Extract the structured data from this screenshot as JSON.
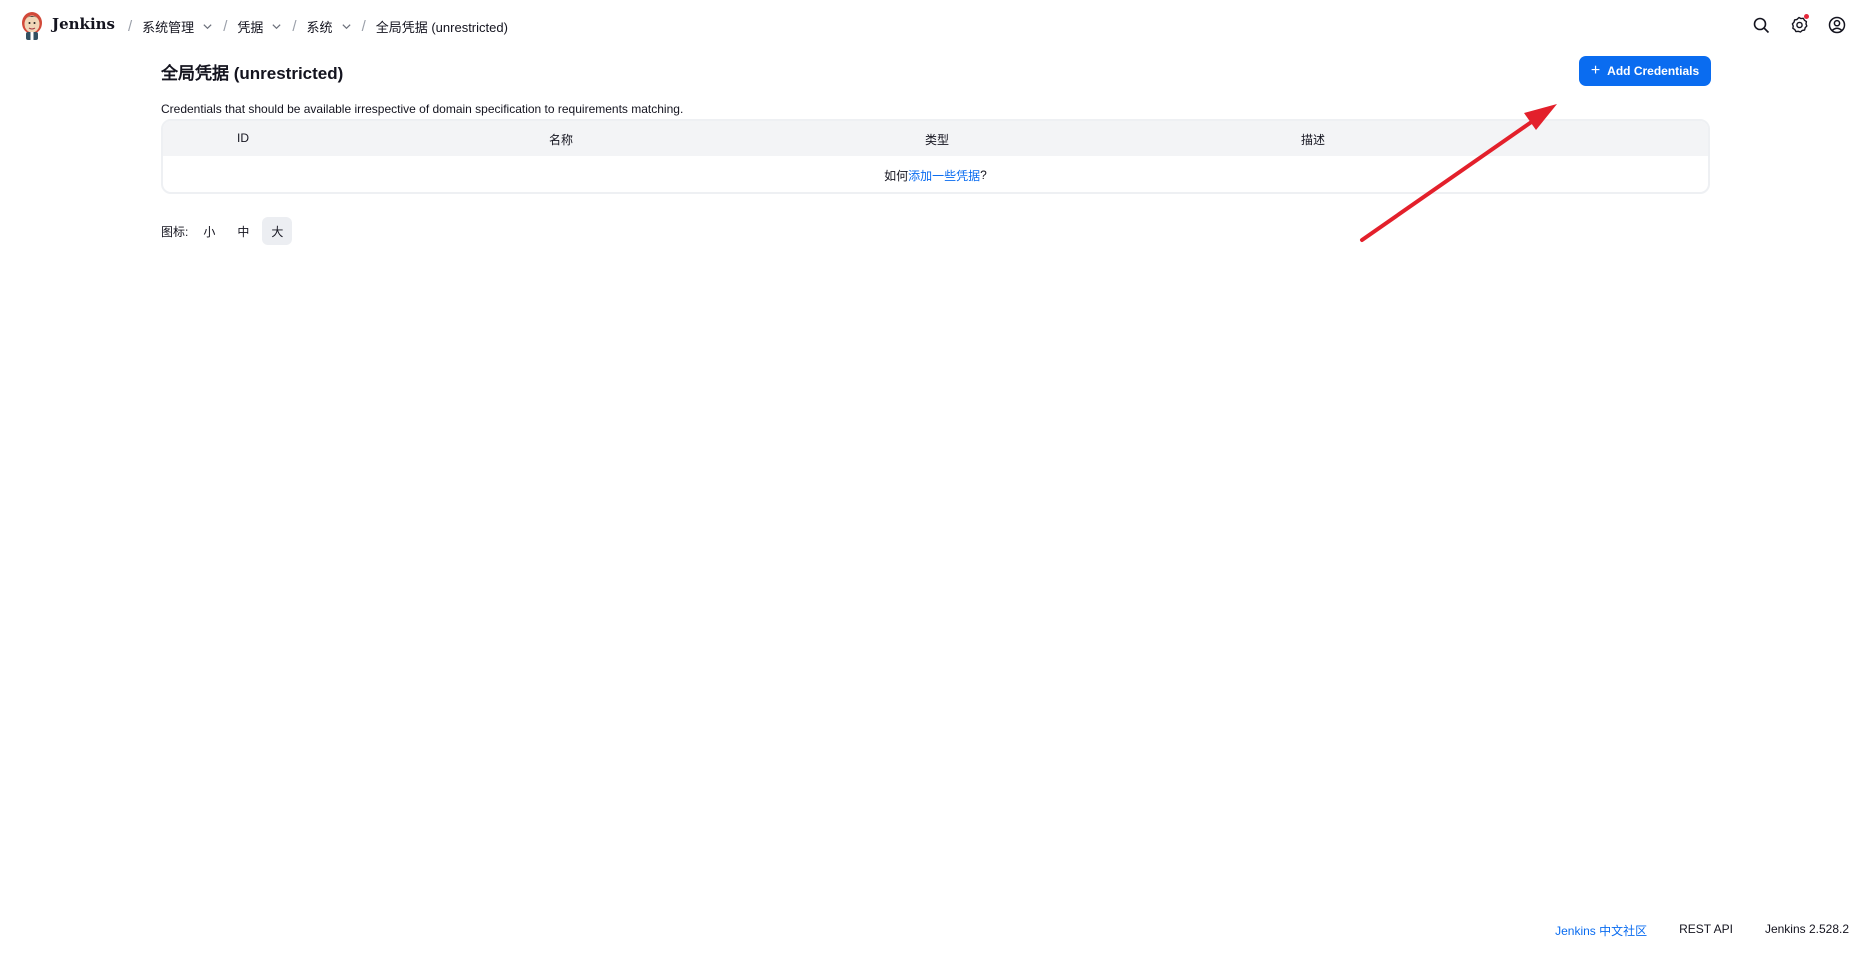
{
  "header": {
    "brand": "Jenkins",
    "breadcrumbs": [
      {
        "label": "系统管理",
        "has_menu": true
      },
      {
        "label": "凭据",
        "has_menu": true
      },
      {
        "label": "系统",
        "has_menu": true
      },
      {
        "label": "全局凭据 (unrestricted)",
        "has_menu": false
      }
    ],
    "icons": [
      "search-icon",
      "settings-gear-icon",
      "user-account-icon"
    ],
    "notification_dot_color": "#e5283b"
  },
  "main": {
    "title": "全局凭据 (unrestricted)",
    "add_button_label": "Add Credentials",
    "description": "Credentials that should be available irrespective of domain specification to requirements matching.",
    "table": {
      "columns": [
        "ID",
        "名称",
        "类型",
        "描述"
      ],
      "empty_prefix": "如何",
      "empty_link": "添加一些凭据",
      "empty_suffix": "?"
    },
    "icon_size": {
      "label": "图标:",
      "options": [
        "小",
        "中",
        "大"
      ],
      "selected": "大"
    }
  },
  "annotation": {
    "arrow_color": "#e3202b"
  },
  "footer": {
    "community_link": "Jenkins 中文社区",
    "rest_api": "REST API",
    "version": "Jenkins 2.528.2"
  },
  "colors": {
    "accent": "#0a6cf0",
    "text": "#14141f"
  }
}
